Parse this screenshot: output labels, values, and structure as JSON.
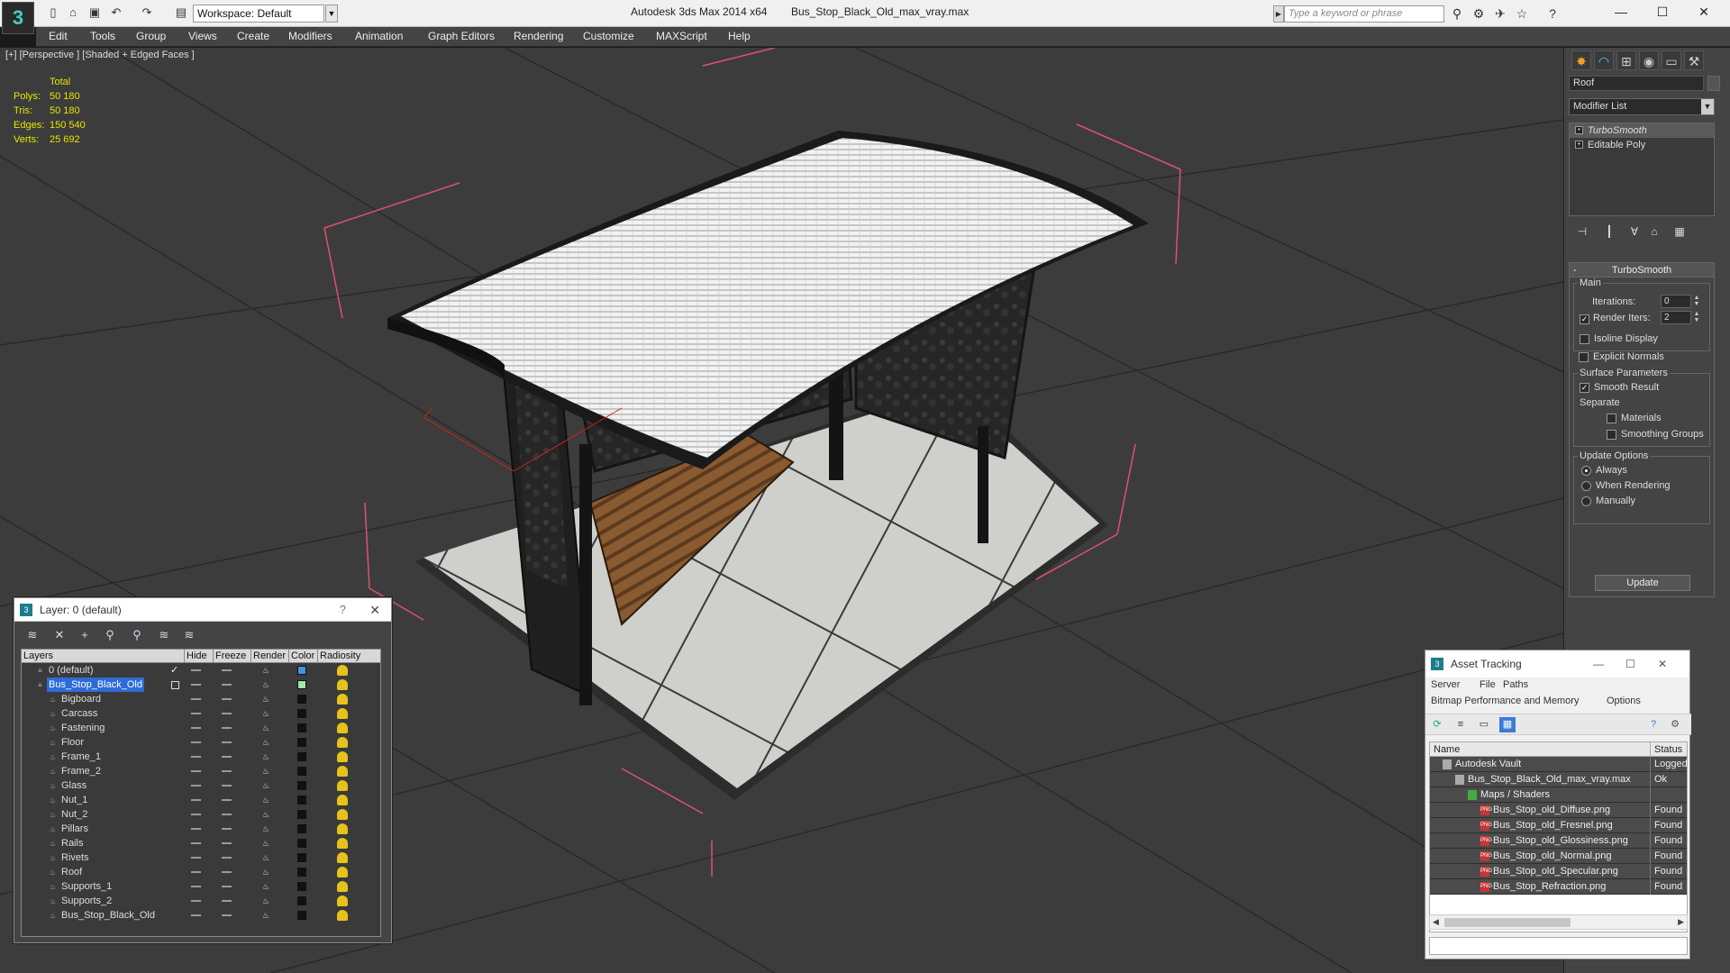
{
  "titlebar": {
    "app_title": "Autodesk 3ds Max 2014 x64",
    "file_title": "Bus_Stop_Black_Old_max_vray.max",
    "workspace": "Workspace: Default",
    "search_placeholder": "Type a keyword or phrase",
    "minimize": "—",
    "maximize": "☐",
    "close": "✕"
  },
  "menu": [
    "Edit",
    "Tools",
    "Group",
    "Views",
    "Create",
    "Modifiers",
    "Animation",
    "Graph Editors",
    "Rendering",
    "Customize",
    "MAXScript",
    "Help"
  ],
  "viewport": {
    "label": "[+] [Perspective ] [Shaded + Edged Faces ]",
    "stats_header": "Total",
    "stats": [
      {
        "k": "Polys:",
        "v": "50 180"
      },
      {
        "k": "Tris:",
        "v": "50 180"
      },
      {
        "k": "Edges:",
        "v": "150 540"
      },
      {
        "k": "Verts:",
        "v": "25 692"
      }
    ]
  },
  "command_panel": {
    "object_name": "Roof",
    "modifier_list": "Modifier List",
    "stack": [
      "TurboSmooth",
      "Editable Poly"
    ],
    "rollout_title": "TurboSmooth",
    "main_group": "Main",
    "iterations_label": "Iterations:",
    "iterations_value": "0",
    "render_iters_label": "Render Iters:",
    "render_iters_value": "2",
    "isoline_display": "Isoline Display",
    "explicit_normals": "Explicit Normals",
    "surface_group": "Surface Parameters",
    "smooth_result": "Smooth Result",
    "separate": "Separate",
    "materials": "Materials",
    "smoothing_groups": "Smoothing Groups",
    "update_group": "Update Options",
    "always": "Always",
    "when_rendering": "When Rendering",
    "manually": "Manually",
    "update_button": "Update"
  },
  "layer_window": {
    "title": "Layer: 0 (default)",
    "help": "?",
    "close": "✕",
    "columns": [
      "Layers",
      "Hide",
      "Freeze",
      "Render",
      "Color",
      "Radiosity"
    ],
    "layers": [
      {
        "name": "0 (default)",
        "level": 0,
        "color": "#4a8fe0",
        "active": true
      },
      {
        "name": "Bus_Stop_Black_Old",
        "level": 0,
        "color": "#9be8a8",
        "selected": true
      },
      {
        "name": "Bigboard",
        "level": 1,
        "color": "#111111"
      },
      {
        "name": "Carcass",
        "level": 1,
        "color": "#111111"
      },
      {
        "name": "Fastening",
        "level": 1,
        "color": "#111111"
      },
      {
        "name": "Floor",
        "level": 1,
        "color": "#111111"
      },
      {
        "name": "Frame_1",
        "level": 1,
        "color": "#111111"
      },
      {
        "name": "Frame_2",
        "level": 1,
        "color": "#111111"
      },
      {
        "name": "Glass",
        "level": 1,
        "color": "#111111"
      },
      {
        "name": "Nut_1",
        "level": 1,
        "color": "#111111"
      },
      {
        "name": "Nut_2",
        "level": 1,
        "color": "#111111"
      },
      {
        "name": "Pillars",
        "level": 1,
        "color": "#111111"
      },
      {
        "name": "Rails",
        "level": 1,
        "color": "#111111"
      },
      {
        "name": "Rivets",
        "level": 1,
        "color": "#111111"
      },
      {
        "name": "Roof",
        "level": 1,
        "color": "#111111"
      },
      {
        "name": "Supports_1",
        "level": 1,
        "color": "#111111"
      },
      {
        "name": "Supports_2",
        "level": 1,
        "color": "#111111"
      },
      {
        "name": "Bus_Stop_Black_Old",
        "level": 1,
        "color": "#111111"
      }
    ]
  },
  "asset_window": {
    "title": "Asset Tracking",
    "menu": [
      "Server",
      "File",
      "Paths",
      "Bitmap Performance and Memory",
      "Options"
    ],
    "columns": [
      "Name",
      "Status"
    ],
    "rows": [
      {
        "name": "Autodesk Vault",
        "status": "Logged",
        "level": 0
      },
      {
        "name": "Bus_Stop_Black_Old_max_vray.max",
        "status": "Ok",
        "level": 1
      },
      {
        "name": "Maps / Shaders",
        "status": "",
        "level": 2
      },
      {
        "name": "Bus_Stop_old_Diffuse.png",
        "status": "Found",
        "level": 3
      },
      {
        "name": "Bus_Stop_old_Fresnel.png",
        "status": "Found",
        "level": 3
      },
      {
        "name": "Bus_Stop_old_Glossiness.png",
        "status": "Found",
        "level": 3
      },
      {
        "name": "Bus_Stop_old_Normal.png",
        "status": "Found",
        "level": 3
      },
      {
        "name": "Bus_Stop_old_Specular.png",
        "status": "Found",
        "level": 3
      },
      {
        "name": "Bus_Stop_Refraction.png",
        "status": "Found",
        "level": 3
      }
    ]
  }
}
